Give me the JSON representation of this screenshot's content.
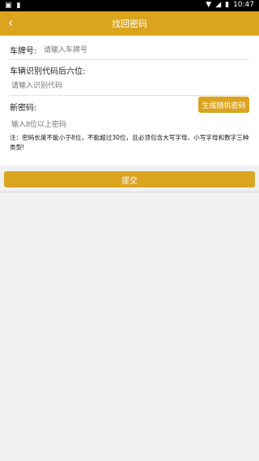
{
  "status": {
    "time": "10:47",
    "left_icons": [
      "notification-box-icon",
      "sim-card-icon"
    ],
    "right_icons": [
      "wifi-icon",
      "signal-icon",
      "battery-icon"
    ]
  },
  "header": {
    "title": "找回密码",
    "back_icon": "chevron-left-icon"
  },
  "form": {
    "plate": {
      "label": "车牌号:",
      "placeholder": "请输入车牌号"
    },
    "vin": {
      "label": "车辆识别代码后六位:",
      "placeholder": "请输入识别代码"
    },
    "password": {
      "label": "新密码:",
      "placeholder": "输入8位以上密码",
      "random_button": "生成随机密码"
    }
  },
  "note": "注：密码长度不能小于8位，不能超过30位，且必须包含大写字母、小写字母和数字三种类型!",
  "submit_label": "提交",
  "colors": {
    "accent": "#dba41f",
    "background": "#f0f0f0"
  }
}
